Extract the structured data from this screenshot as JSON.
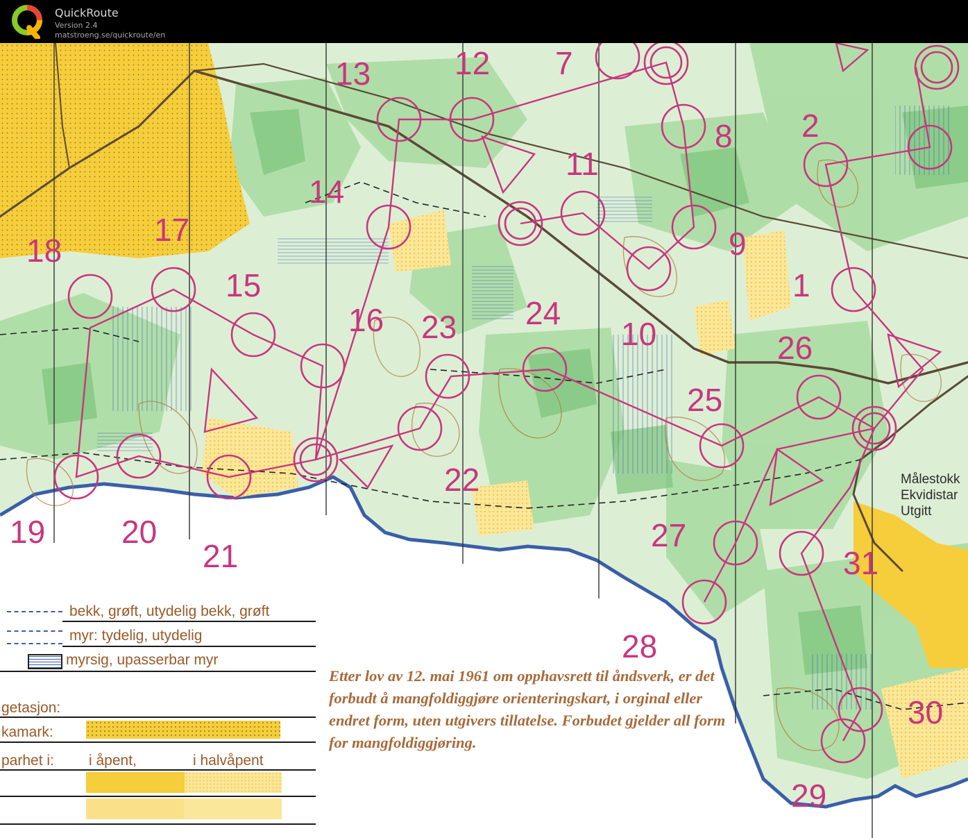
{
  "header": {
    "app_name": "QuickRoute",
    "version": "Version 2.4",
    "url": "matstroeng.se/quickroute/en"
  },
  "map": {
    "colors": {
      "route": "#c8367e",
      "forest_light": "#c8e6c2",
      "forest_dark": "#8fcf8f",
      "open_yellow": "#f6cd3a",
      "semi_open": "#fbe79a",
      "contour": "#b27a3c",
      "water_edge": "#3a5fa8"
    },
    "control_numbers": [
      "1",
      "2",
      "7",
      "8",
      "9",
      "10",
      "11",
      "12",
      "13",
      "14",
      "15",
      "16",
      "17",
      "18",
      "19",
      "20",
      "21",
      "22",
      "23",
      "24",
      "25",
      "26",
      "27",
      "28",
      "29",
      "30",
      "31"
    ],
    "scale_text": {
      "line1": "Målestokk",
      "line2": "Ekvidistar",
      "line3": "Utgitt"
    },
    "legend": {
      "stream": "bekk, grøft, utydelig bekk, grøft",
      "marsh": "myr: tydelig, utydelig",
      "wet_marsh": "myrsig, upasserbar myr",
      "vegetation": "getasjon:",
      "field": "kamark:",
      "passability": "parhet i:",
      "open": "i åpent,",
      "semi_open": "i  halvåpent"
    },
    "copyright": "Etter lov av 12. mai 1961 om opphavsrett til åndsverk, er det forbudt å mangfoldiggjøre orienteringskart, i orginal eller endret form, uten utgivers tillatelse. Forbudet gjelder all form for mangfoldiggjøring."
  }
}
